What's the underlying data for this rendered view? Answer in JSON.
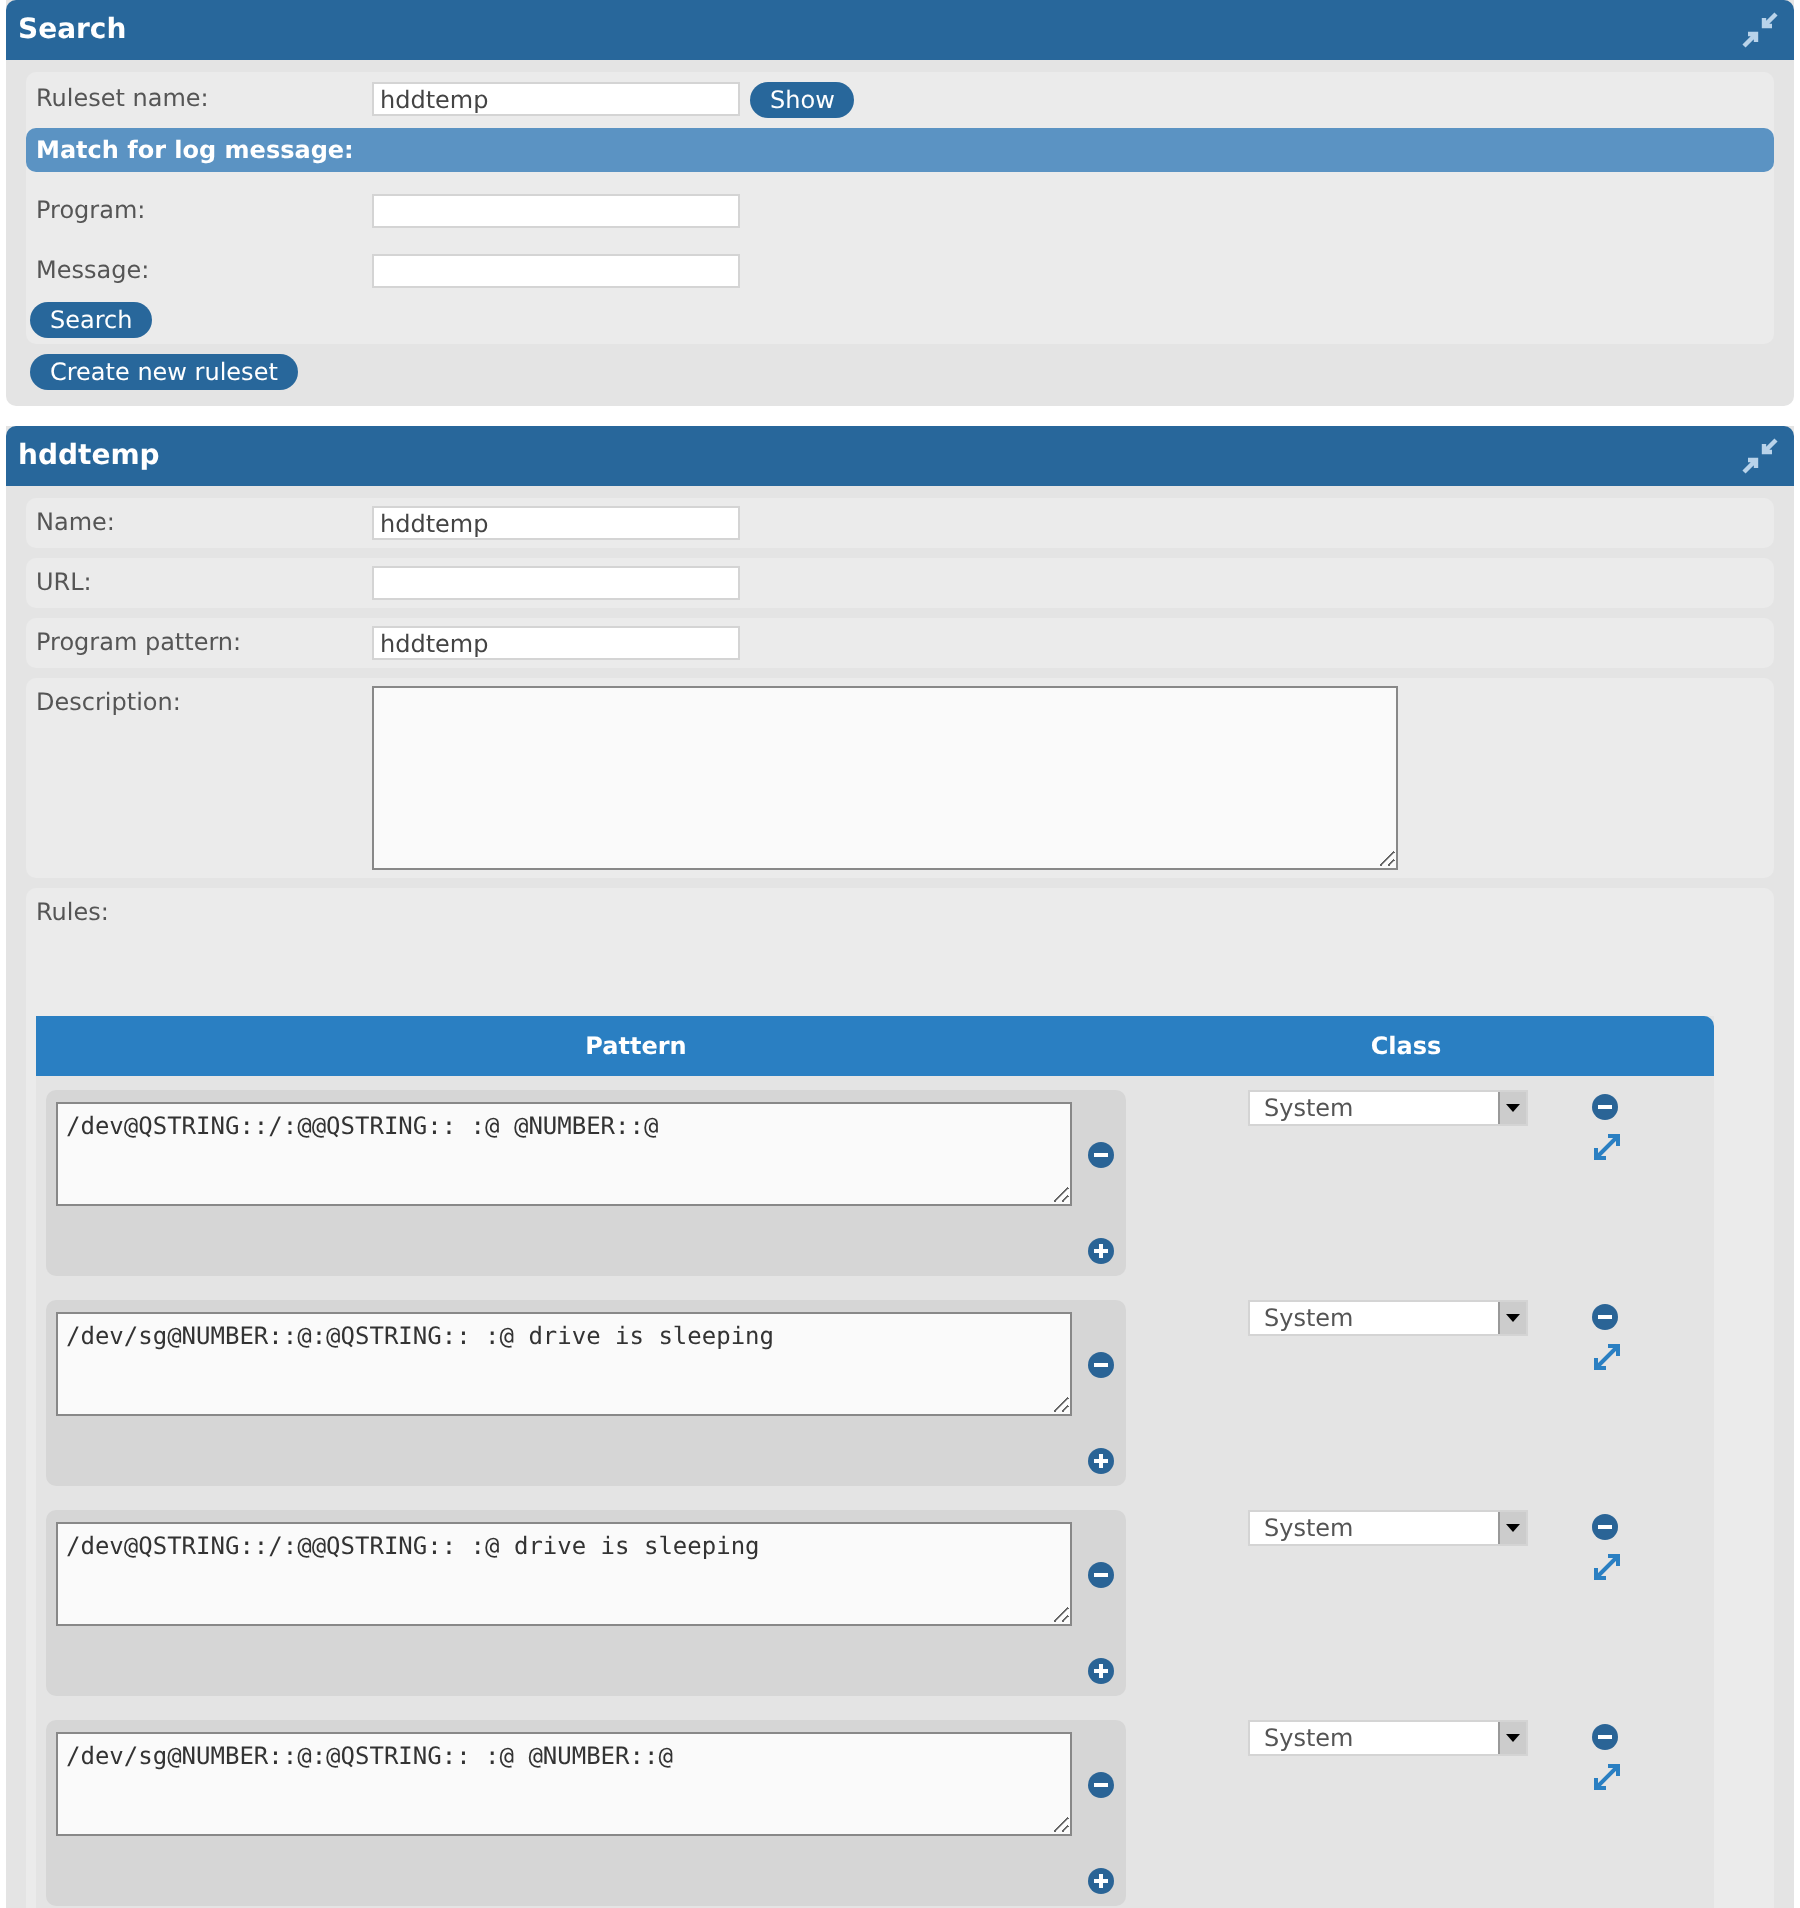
{
  "search_panel": {
    "title": "Search",
    "ruleset_name": {
      "label": "Ruleset name:",
      "value": "hddtemp"
    },
    "show_button": "Show",
    "match_heading": "Match for log message:",
    "fields": [
      {
        "label": "Program:"
      },
      {
        "label": "Message:"
      }
    ],
    "search_button": "Search",
    "create_button": "Create new ruleset"
  },
  "ruleset_panel": {
    "title": "hddtemp",
    "fields": [
      {
        "kind": "text",
        "label": "Name:",
        "value": "hddtemp"
      },
      {
        "kind": "text",
        "label": "URL:"
      },
      {
        "kind": "text",
        "label": "Program pattern:",
        "value": "hddtemp"
      },
      {
        "kind": "textarea",
        "label": "Description:"
      }
    ],
    "rules_label": "Rules:",
    "rules_table": {
      "columns": [
        "Pattern",
        "Class"
      ],
      "rows": [
        {
          "pattern": "/dev@QSTRING::/:@@QSTRING:: :@ @NUMBER::@",
          "class": "System"
        },
        {
          "pattern": "/dev/sg@NUMBER::@:@QSTRING:: :@ drive is sleeping",
          "class": "System"
        },
        {
          "pattern": "/dev@QSTRING::/:@@QSTRING:: :@ drive is sleeping",
          "class": "System"
        },
        {
          "pattern": "/dev/sg@NUMBER::@:@QSTRING:: :@ @NUMBER::@",
          "class": "System"
        }
      ]
    }
  }
}
